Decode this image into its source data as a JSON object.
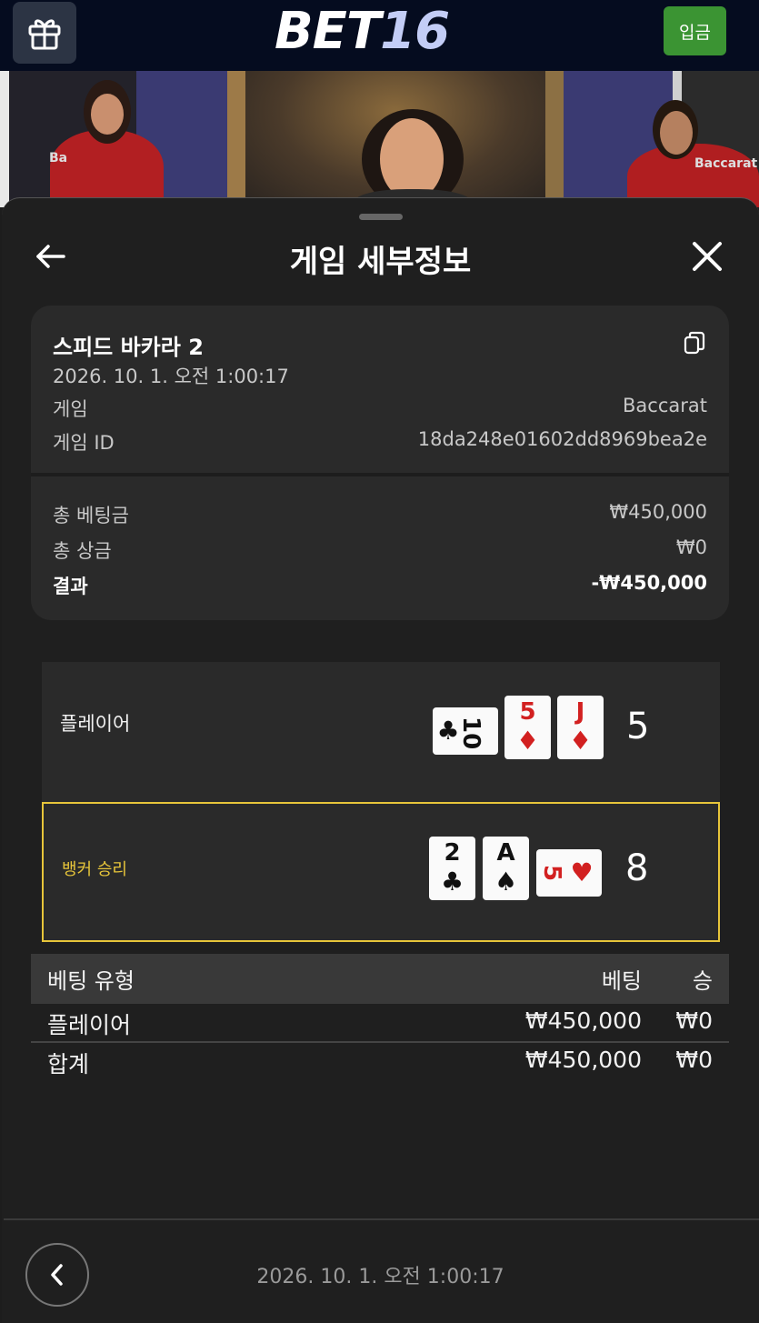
{
  "header": {
    "logo_main": "BET",
    "logo_num": "16",
    "deposit_label": "입금",
    "gift_icon": "gift-icon"
  },
  "video": {
    "badge_left": "Ba",
    "badge_right": "Baccarat"
  },
  "sheet": {
    "title": "게임 세부정보",
    "back_icon": "arrow-left-icon",
    "close_icon": "close-icon"
  },
  "info": {
    "game_name": "스피드 바카라 2",
    "date": "2026. 10. 1. 오전 1:00:17",
    "game_label": "게임",
    "game_value": "Baccarat",
    "game_id_label": "게임 ID",
    "game_id_value": "18da248e01602dd8969bea2e",
    "total_bet_label": "총 베팅금",
    "total_bet_value": "₩450,000",
    "total_win_label": "총 상금",
    "total_win_value": "₩0",
    "result_label": "결과",
    "result_value": "-₩450,000"
  },
  "hands": {
    "player": {
      "label": "플레이어",
      "score": "5",
      "cards": [
        {
          "rank": "10",
          "suit": "♣",
          "color": "black",
          "sideways": true
        },
        {
          "rank": "5",
          "suit": "♦",
          "color": "red",
          "sideways": false
        },
        {
          "rank": "J",
          "suit": "♦",
          "color": "red",
          "sideways": false
        }
      ]
    },
    "banker": {
      "label": "뱅커 승리",
      "score": "8",
      "cards": [
        {
          "rank": "2",
          "suit": "♣",
          "color": "black",
          "sideways": false
        },
        {
          "rank": "A",
          "suit": "♠",
          "color": "black",
          "sideways": false
        },
        {
          "rank": "5",
          "suit": "♥",
          "color": "red",
          "sideways": true
        }
      ]
    }
  },
  "bets": {
    "headers": [
      "베팅 유형",
      "베팅",
      "승"
    ],
    "rows": [
      {
        "type": "플레이어",
        "bet": "₩450,000",
        "win": "₩0"
      },
      {
        "type": "합계",
        "bet": "₩450,000",
        "win": "₩0"
      }
    ]
  },
  "footer": {
    "date": "2026. 10. 1. 오전 1:00:17",
    "back_icon": "chevron-left-icon"
  },
  "colors": {
    "accent_gold": "#e7c53a",
    "deposit_green": "#3b9433",
    "card_red": "#d22020"
  }
}
